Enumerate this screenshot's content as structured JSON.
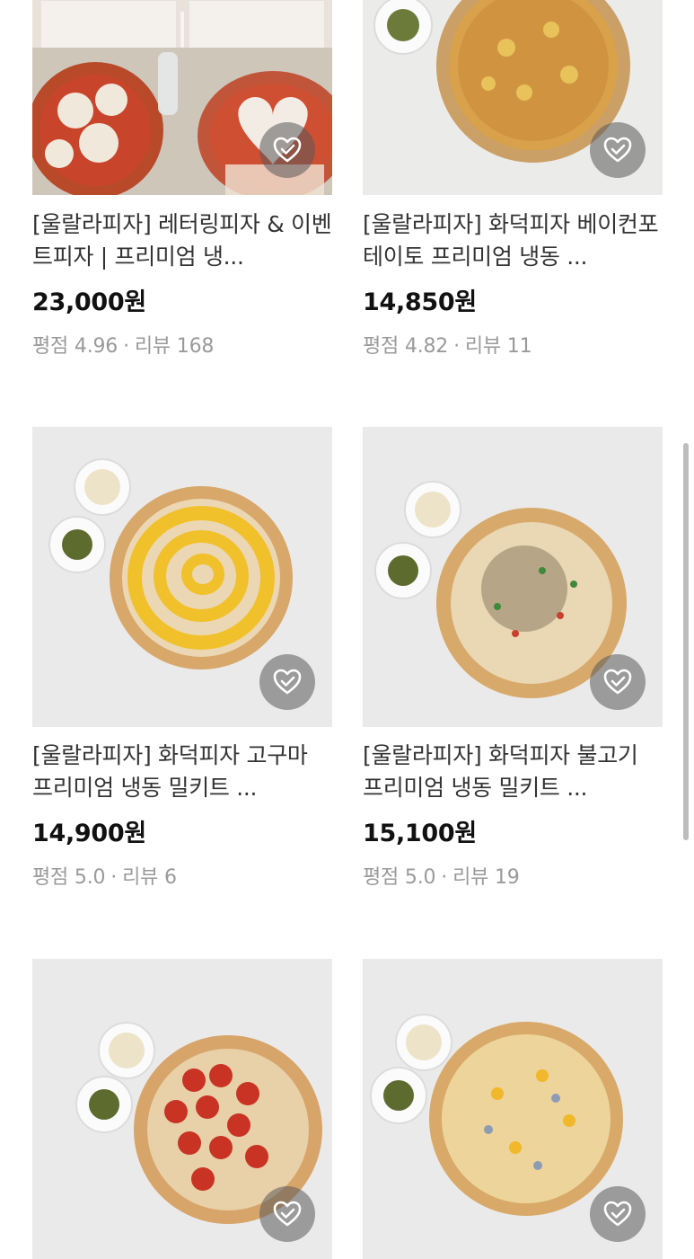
{
  "products": [
    {
      "title": "[울랄라피자] 레터링피자 & 이벤트피자 | 프리미엄 냉...",
      "price": "23,000원",
      "rating_label": "평점",
      "rating": "4.96",
      "review_label": "리뷰",
      "reviews": "168"
    },
    {
      "title": "[울랄라피자] 화덕피자 베이컨포테이토 프리미엄 냉동 ...",
      "price": "14,850원",
      "rating_label": "평점",
      "rating": "4.82",
      "review_label": "리뷰",
      "reviews": "11"
    },
    {
      "title": "[울랄라피자] 화덕피자 고구마 프리미엄 냉동 밀키트 ...",
      "price": "14,900원",
      "rating_label": "평점",
      "rating": "5.0",
      "review_label": "리뷰",
      "reviews": "6"
    },
    {
      "title": "[울랄라피자] 화덕피자 불고기 프리미엄 냉동 밀키트 ...",
      "price": "15,100원",
      "rating_label": "평점",
      "rating": "5.0",
      "review_label": "리뷰",
      "reviews": "19"
    },
    {
      "title": "",
      "price": "",
      "rating_label": "",
      "rating": "",
      "review_label": "",
      "reviews": ""
    },
    {
      "title": "",
      "price": "",
      "rating_label": "",
      "rating": "",
      "review_label": "",
      "reviews": ""
    }
  ],
  "icons": {
    "favorite": "heart-check-icon"
  },
  "colors": {
    "price": "#111111",
    "meta": "#9a9a9a",
    "title": "#333333"
  }
}
